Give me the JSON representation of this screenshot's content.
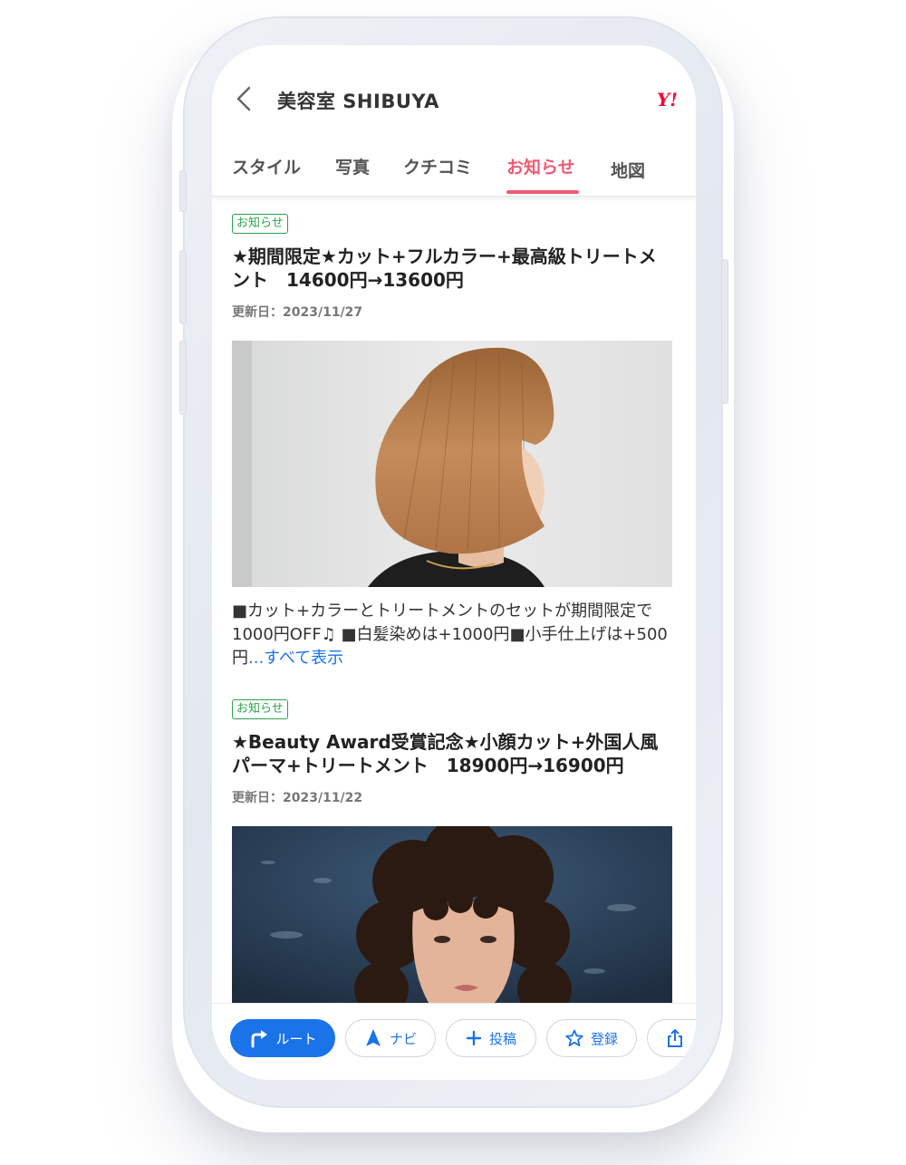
{
  "header": {
    "back_icon": "chevron-left-icon",
    "title": "美容室 SHIBUYA",
    "brand_logo": "Y!"
  },
  "tabs": [
    {
      "label": "スタイル"
    },
    {
      "label": "写真"
    },
    {
      "label": "クチコミ"
    },
    {
      "label": "お知らせ",
      "active": true
    },
    {
      "label": "地図"
    }
  ],
  "posts": [
    {
      "badge": "お知らせ",
      "title": "★期間限定★カット+フルカラー+最高級トリートメント　14600円→13600円",
      "date": "更新日：2023/11/27",
      "image": "bob-haircut-photo",
      "body": "■カット+カラーとトリートメントのセットが期間限定で1000円OFF♫ ■白髪染めは+1000円■小手仕上げは+500円",
      "more_link": "...すべて表示"
    },
    {
      "badge": "お知らせ",
      "title": "★Beauty Award受賞記念★小顔カット+外国人風パーマ+トリートメント　18900円→16900円",
      "date": "更新日：2023/11/22",
      "image": "curly-perm-photo"
    }
  ],
  "actions": [
    {
      "label": "ルート",
      "icon": "route-turn-icon"
    },
    {
      "label": "ナビ",
      "icon": "navigation-arrow-icon"
    },
    {
      "label": "投稿",
      "icon": "plus-icon"
    },
    {
      "label": "登録",
      "icon": "star-icon"
    },
    {
      "label": "",
      "icon": "share-icon"
    }
  ],
  "colors": {
    "accent": "#ee5a73",
    "link": "#1a73e8",
    "badge": "#2ca24a",
    "brand": "#ff0033"
  }
}
